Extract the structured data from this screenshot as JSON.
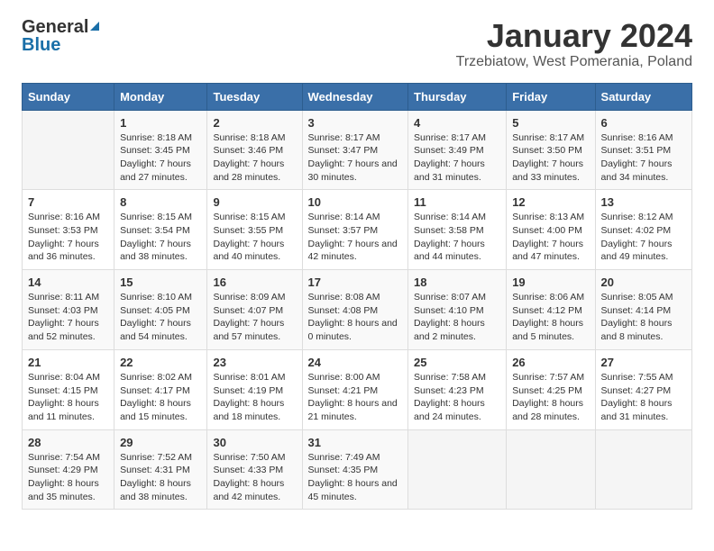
{
  "header": {
    "logo_general": "General",
    "logo_blue": "Blue",
    "month_title": "January 2024",
    "location": "Trzebiatow, West Pomerania, Poland"
  },
  "days_of_week": [
    "Sunday",
    "Monday",
    "Tuesday",
    "Wednesday",
    "Thursday",
    "Friday",
    "Saturday"
  ],
  "weeks": [
    [
      {
        "day": "",
        "sunrise": "",
        "sunset": "",
        "daylight": ""
      },
      {
        "day": "1",
        "sunrise": "Sunrise: 8:18 AM",
        "sunset": "Sunset: 3:45 PM",
        "daylight": "Daylight: 7 hours and 27 minutes."
      },
      {
        "day": "2",
        "sunrise": "Sunrise: 8:18 AM",
        "sunset": "Sunset: 3:46 PM",
        "daylight": "Daylight: 7 hours and 28 minutes."
      },
      {
        "day": "3",
        "sunrise": "Sunrise: 8:17 AM",
        "sunset": "Sunset: 3:47 PM",
        "daylight": "Daylight: 7 hours and 30 minutes."
      },
      {
        "day": "4",
        "sunrise": "Sunrise: 8:17 AM",
        "sunset": "Sunset: 3:49 PM",
        "daylight": "Daylight: 7 hours and 31 minutes."
      },
      {
        "day": "5",
        "sunrise": "Sunrise: 8:17 AM",
        "sunset": "Sunset: 3:50 PM",
        "daylight": "Daylight: 7 hours and 33 minutes."
      },
      {
        "day": "6",
        "sunrise": "Sunrise: 8:16 AM",
        "sunset": "Sunset: 3:51 PM",
        "daylight": "Daylight: 7 hours and 34 minutes."
      }
    ],
    [
      {
        "day": "7",
        "sunrise": "Sunrise: 8:16 AM",
        "sunset": "Sunset: 3:53 PM",
        "daylight": "Daylight: 7 hours and 36 minutes."
      },
      {
        "day": "8",
        "sunrise": "Sunrise: 8:15 AM",
        "sunset": "Sunset: 3:54 PM",
        "daylight": "Daylight: 7 hours and 38 minutes."
      },
      {
        "day": "9",
        "sunrise": "Sunrise: 8:15 AM",
        "sunset": "Sunset: 3:55 PM",
        "daylight": "Daylight: 7 hours and 40 minutes."
      },
      {
        "day": "10",
        "sunrise": "Sunrise: 8:14 AM",
        "sunset": "Sunset: 3:57 PM",
        "daylight": "Daylight: 7 hours and 42 minutes."
      },
      {
        "day": "11",
        "sunrise": "Sunrise: 8:14 AM",
        "sunset": "Sunset: 3:58 PM",
        "daylight": "Daylight: 7 hours and 44 minutes."
      },
      {
        "day": "12",
        "sunrise": "Sunrise: 8:13 AM",
        "sunset": "Sunset: 4:00 PM",
        "daylight": "Daylight: 7 hours and 47 minutes."
      },
      {
        "day": "13",
        "sunrise": "Sunrise: 8:12 AM",
        "sunset": "Sunset: 4:02 PM",
        "daylight": "Daylight: 7 hours and 49 minutes."
      }
    ],
    [
      {
        "day": "14",
        "sunrise": "Sunrise: 8:11 AM",
        "sunset": "Sunset: 4:03 PM",
        "daylight": "Daylight: 7 hours and 52 minutes."
      },
      {
        "day": "15",
        "sunrise": "Sunrise: 8:10 AM",
        "sunset": "Sunset: 4:05 PM",
        "daylight": "Daylight: 7 hours and 54 minutes."
      },
      {
        "day": "16",
        "sunrise": "Sunrise: 8:09 AM",
        "sunset": "Sunset: 4:07 PM",
        "daylight": "Daylight: 7 hours and 57 minutes."
      },
      {
        "day": "17",
        "sunrise": "Sunrise: 8:08 AM",
        "sunset": "Sunset: 4:08 PM",
        "daylight": "Daylight: 8 hours and 0 minutes."
      },
      {
        "day": "18",
        "sunrise": "Sunrise: 8:07 AM",
        "sunset": "Sunset: 4:10 PM",
        "daylight": "Daylight: 8 hours and 2 minutes."
      },
      {
        "day": "19",
        "sunrise": "Sunrise: 8:06 AM",
        "sunset": "Sunset: 4:12 PM",
        "daylight": "Daylight: 8 hours and 5 minutes."
      },
      {
        "day": "20",
        "sunrise": "Sunrise: 8:05 AM",
        "sunset": "Sunset: 4:14 PM",
        "daylight": "Daylight: 8 hours and 8 minutes."
      }
    ],
    [
      {
        "day": "21",
        "sunrise": "Sunrise: 8:04 AM",
        "sunset": "Sunset: 4:15 PM",
        "daylight": "Daylight: 8 hours and 11 minutes."
      },
      {
        "day": "22",
        "sunrise": "Sunrise: 8:02 AM",
        "sunset": "Sunset: 4:17 PM",
        "daylight": "Daylight: 8 hours and 15 minutes."
      },
      {
        "day": "23",
        "sunrise": "Sunrise: 8:01 AM",
        "sunset": "Sunset: 4:19 PM",
        "daylight": "Daylight: 8 hours and 18 minutes."
      },
      {
        "day": "24",
        "sunrise": "Sunrise: 8:00 AM",
        "sunset": "Sunset: 4:21 PM",
        "daylight": "Daylight: 8 hours and 21 minutes."
      },
      {
        "day": "25",
        "sunrise": "Sunrise: 7:58 AM",
        "sunset": "Sunset: 4:23 PM",
        "daylight": "Daylight: 8 hours and 24 minutes."
      },
      {
        "day": "26",
        "sunrise": "Sunrise: 7:57 AM",
        "sunset": "Sunset: 4:25 PM",
        "daylight": "Daylight: 8 hours and 28 minutes."
      },
      {
        "day": "27",
        "sunrise": "Sunrise: 7:55 AM",
        "sunset": "Sunset: 4:27 PM",
        "daylight": "Daylight: 8 hours and 31 minutes."
      }
    ],
    [
      {
        "day": "28",
        "sunrise": "Sunrise: 7:54 AM",
        "sunset": "Sunset: 4:29 PM",
        "daylight": "Daylight: 8 hours and 35 minutes."
      },
      {
        "day": "29",
        "sunrise": "Sunrise: 7:52 AM",
        "sunset": "Sunset: 4:31 PM",
        "daylight": "Daylight: 8 hours and 38 minutes."
      },
      {
        "day": "30",
        "sunrise": "Sunrise: 7:50 AM",
        "sunset": "Sunset: 4:33 PM",
        "daylight": "Daylight: 8 hours and 42 minutes."
      },
      {
        "day": "31",
        "sunrise": "Sunrise: 7:49 AM",
        "sunset": "Sunset: 4:35 PM",
        "daylight": "Daylight: 8 hours and 45 minutes."
      },
      {
        "day": "",
        "sunrise": "",
        "sunset": "",
        "daylight": ""
      },
      {
        "day": "",
        "sunrise": "",
        "sunset": "",
        "daylight": ""
      },
      {
        "day": "",
        "sunrise": "",
        "sunset": "",
        "daylight": ""
      }
    ]
  ]
}
